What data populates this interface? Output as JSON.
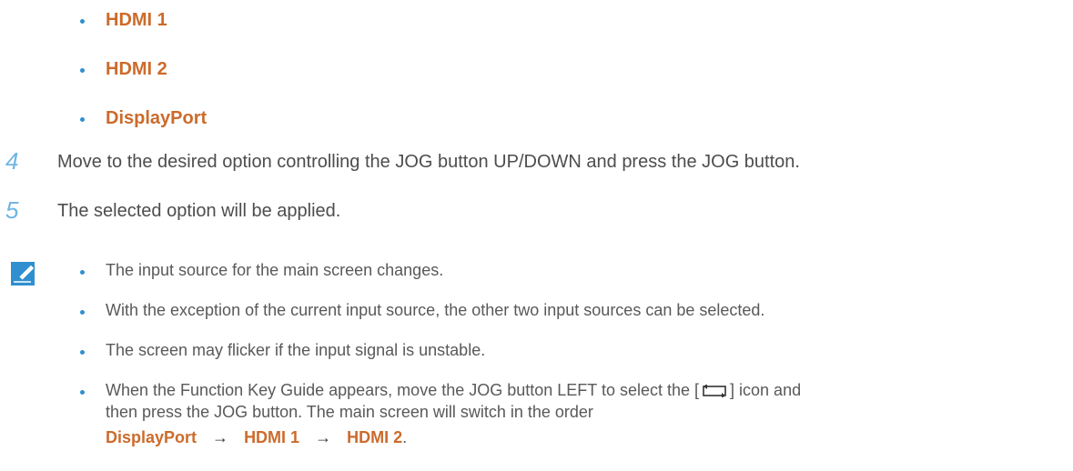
{
  "options": [
    "HDMI 1",
    "HDMI 2",
    "DisplayPort"
  ],
  "steps": [
    {
      "num": "4",
      "text": "Move to the desired option controlling the JOG button UP/DOWN and press the JOG button."
    },
    {
      "num": "5",
      "text": "The selected option will be applied."
    }
  ],
  "notes": [
    "The input source for the main screen changes.",
    "With the exception of the current input source, the other two input sources can be selected.",
    "The screen may flicker if the input signal is unstable."
  ],
  "last_note": {
    "before_icon": "When the Function Key Guide appears, move the JOG button LEFT to select the [",
    "icon": "switch-screen-icon",
    "after_icon": "] icon and",
    "line2": "then press the JOG button. The main screen will switch in the order",
    "order": [
      "DisplayPort",
      "HDMI 1",
      "HDMI 2"
    ],
    "arrow": "→",
    "end": "."
  },
  "colors": {
    "accent": "#cc6b2c",
    "bullet": "#2f8fd0",
    "step_number": "#6fb6e4",
    "body": "#4d4d4d"
  }
}
